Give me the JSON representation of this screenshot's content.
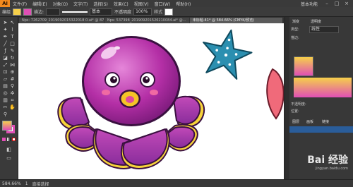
{
  "app": {
    "logo_text": "Ai",
    "workspace_label": "基本功能"
  },
  "menu": [
    "文件(F)",
    "编辑(E)",
    "对象(O)",
    "文字(T)",
    "选择(S)",
    "效果(C)",
    "视图(V)",
    "窗口(W)",
    "帮助(H)"
  ],
  "options_bar": {
    "selection_label": "编组",
    "stroke_label": "描边:",
    "style_label": "基本",
    "opacity_label": "不透明度",
    "opacity_value": "100%",
    "style_name": "样式"
  },
  "tabs": [
    {
      "label": "Nps: 7262709_2019092015322018 0.ai* @ 87...",
      "active": false
    },
    {
      "label": "Nps: 537398_201909201526210084.ai* @...",
      "active": false
    },
    {
      "label": "未标题-41* @ 584.66% (CMYK/预览)",
      "active": true
    }
  ],
  "status_bar": {
    "zoom": "584.66%",
    "page": "1",
    "tool_name": "直接选择"
  },
  "panel": {
    "tab_gradient": "渐变",
    "tab_transparency": "透明度",
    "type_label": "类型:",
    "type_value": "线性",
    "stroke_label": "描边:",
    "opacity_label": "不透明度:",
    "location_label": "位置:",
    "layers_tab": "图层",
    "artboards_tab": "画板",
    "links_tab": "链接"
  },
  "watermark": {
    "text": "Bai 经验",
    "sub": "jingyan.baidu.com"
  },
  "icons": [
    "selection-icon",
    "direct-selection-icon",
    "pen-icon",
    "type-icon",
    "line-icon",
    "rectangle-icon",
    "brush-icon",
    "pencil-icon",
    "eraser-icon",
    "rotate-icon",
    "scale-icon",
    "width-icon",
    "free-transform-icon",
    "shape-builder-icon",
    "perspective-icon",
    "mesh-icon",
    "gradient-icon",
    "eyedropper-icon",
    "blend-icon",
    "symbol-sprayer-icon",
    "graph-icon",
    "artboard-icon",
    "slice-icon",
    "hand-icon",
    "zoom-icon"
  ],
  "colors": {
    "accent": "#f48a1e",
    "fill": "#f6d04a",
    "stroke": "#e04fb5"
  }
}
